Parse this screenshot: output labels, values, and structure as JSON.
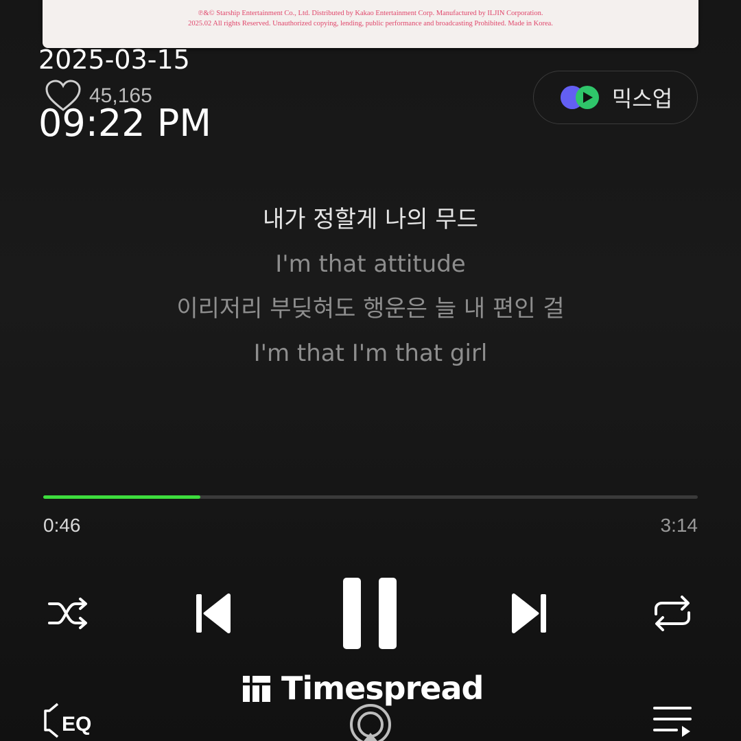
{
  "album_credits": {
    "line1": "℗&© Starship Entertainment Co., Ltd. Distributed by Kakao Entertainment Corp. Manufactured by ILJIN Corporation.",
    "line2": "2025.02 All rights Reserved. Unauthorized copying, lending, public performance and broadcasting Prohibited. Made in Korea."
  },
  "overlay": {
    "date": "2025-03-15",
    "time": "09:22 PM"
  },
  "like": {
    "count": "45,165"
  },
  "mixup": {
    "label": "믹스업"
  },
  "lyrics": [
    "내가 정할게 나의 무드",
    "I'm that attitude",
    "이리저리 부딪혀도 행운은 늘 내 편인 걸",
    "I'm that I'm that girl"
  ],
  "playback": {
    "current_time": "0:46",
    "total_time": "3:14",
    "progress": 0.24
  },
  "watermark": {
    "text": "Timespread"
  },
  "bottom_bar": {
    "eq_label": "EQ"
  },
  "colors": {
    "accent": "#3ddc3d",
    "background": "#161616",
    "credits": "#e0456a"
  }
}
